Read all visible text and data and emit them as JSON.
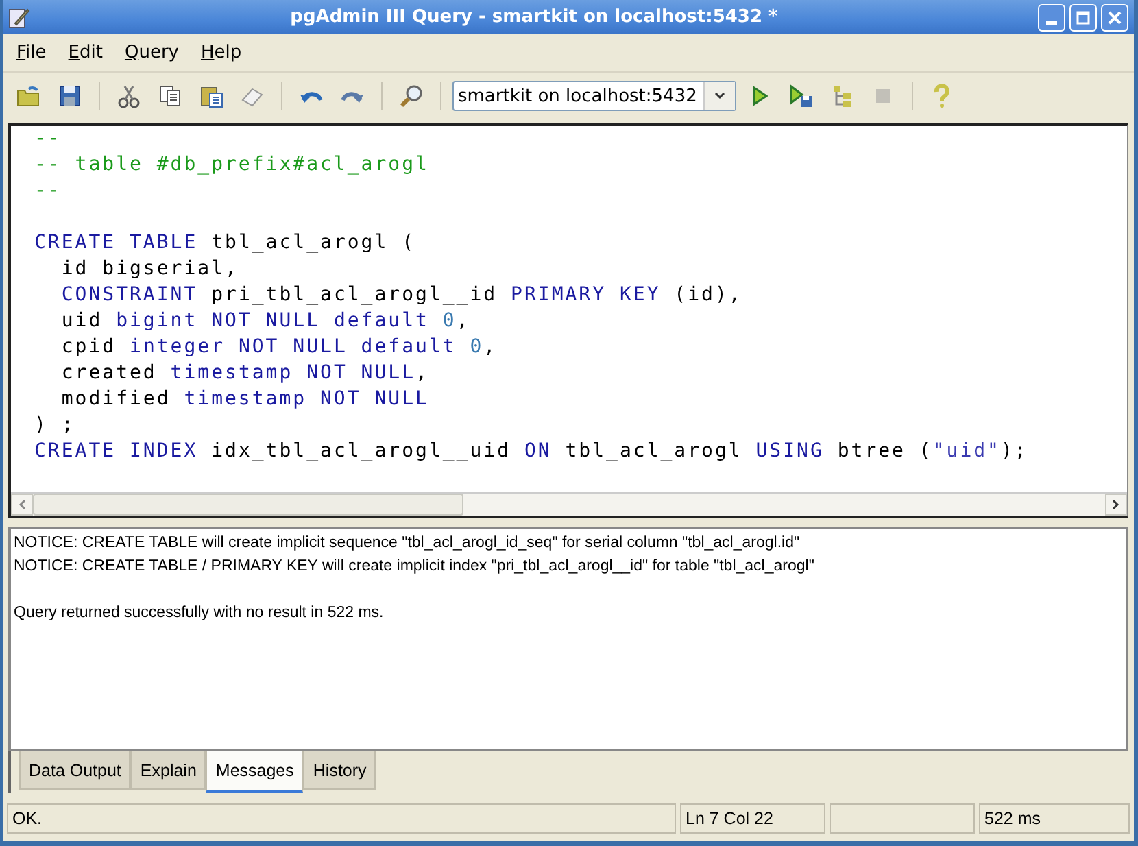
{
  "window": {
    "title": "pgAdmin III Query - smartkit on localhost:5432 *"
  },
  "menu": [
    {
      "label": "File"
    },
    {
      "label": "Edit"
    },
    {
      "label": "Query"
    },
    {
      "label": "Help"
    }
  ],
  "toolbar": {
    "buttons": [
      {
        "disabled": false
      },
      {
        "disabled": false
      },
      {
        "disabled": false
      },
      {
        "disabled": false
      },
      {
        "disabled": false
      },
      {
        "disabled": false
      },
      {
        "disabled": false
      },
      {
        "disabled": false
      },
      {
        "disabled": false
      }
    ],
    "connection": {
      "value": "smartkit on localhost:5432"
    },
    "run_buttons": [
      {
        "disabled": false
      },
      {
        "disabled": false
      },
      {
        "disabled": false
      },
      {
        "disabled": true
      },
      {
        "disabled": false
      }
    ]
  },
  "editor": {
    "lines": [
      {
        "kind": "code",
        "tokens": [
          {
            "kind": "comment",
            "text": "--"
          }
        ]
      },
      {
        "kind": "code",
        "tokens": [
          {
            "kind": "comment",
            "text": "-- table #db_prefix#acl_arogl"
          }
        ]
      },
      {
        "kind": "code",
        "tokens": [
          {
            "kind": "comment",
            "text": "--"
          }
        ]
      },
      {
        "kind": "blank"
      },
      {
        "kind": "code",
        "tokens": [
          {
            "kind": "keyword",
            "text": "CREATE TABLE"
          },
          {
            "kind": "plain",
            "text": " tbl_acl_arogl ("
          }
        ]
      },
      {
        "kind": "code",
        "tokens": [
          {
            "kind": "plain",
            "text": "  id bigserial,"
          }
        ]
      },
      {
        "kind": "code",
        "tokens": [
          {
            "kind": "keyword",
            "text": "  CONSTRAINT"
          },
          {
            "kind": "plain",
            "text": " pri_tbl_acl_arogl__id "
          },
          {
            "kind": "keyword",
            "text": "PRIMARY KEY"
          },
          {
            "kind": "plain",
            "text": " (id),"
          }
        ]
      },
      {
        "kind": "code",
        "tokens": [
          {
            "kind": "plain",
            "text": "  uid "
          },
          {
            "kind": "keyword",
            "text": "bigint NOT NULL default"
          },
          {
            "kind": "number",
            "text": " 0"
          },
          {
            "kind": "plain",
            "text": ","
          }
        ]
      },
      {
        "kind": "code",
        "tokens": [
          {
            "kind": "plain",
            "text": "  cpid "
          },
          {
            "kind": "keyword",
            "text": "integer NOT NULL default"
          },
          {
            "kind": "number",
            "text": " 0"
          },
          {
            "kind": "plain",
            "text": ","
          }
        ]
      },
      {
        "kind": "code",
        "tokens": [
          {
            "kind": "plain",
            "text": "  created "
          },
          {
            "kind": "keyword",
            "text": "timestamp NOT NULL"
          },
          {
            "kind": "plain",
            "text": ","
          }
        ]
      },
      {
        "kind": "code",
        "tokens": [
          {
            "kind": "plain",
            "text": "  modified "
          },
          {
            "kind": "keyword",
            "text": "timestamp NOT NULL"
          }
        ]
      },
      {
        "kind": "code",
        "tokens": [
          {
            "kind": "plain",
            "text": ") ;"
          }
        ]
      },
      {
        "kind": "code",
        "tokens": [
          {
            "kind": "keyword",
            "text": "CREATE INDEX"
          },
          {
            "kind": "plain",
            "text": " idx_tbl_acl_arogl__uid "
          },
          {
            "kind": "keyword",
            "text": "ON"
          },
          {
            "kind": "plain",
            "text": " tbl_acl_arogl "
          },
          {
            "kind": "keyword",
            "text": "USING"
          },
          {
            "kind": "plain",
            "text": " btree ("
          },
          {
            "kind": "string",
            "text": "\"uid\""
          },
          {
            "kind": "plain",
            "text": ");"
          }
        ]
      }
    ]
  },
  "messages": [
    {
      "kind": "notice",
      "text": "NOTICE:  CREATE TABLE will create implicit sequence \"tbl_acl_arogl_id_seq\" for serial column \"tbl_acl_arogl.id\""
    },
    {
      "kind": "notice",
      "text": "NOTICE:  CREATE TABLE / PRIMARY KEY will create implicit index \"pri_tbl_acl_arogl__id\" for table \"tbl_acl_arogl\""
    },
    {
      "kind": "result",
      "text": "Query returned successfully with no result in 522 ms."
    }
  ],
  "tabs": [
    {
      "label": "Data Output",
      "selected": false
    },
    {
      "label": "Explain",
      "selected": false
    },
    {
      "label": "Messages",
      "selected": true
    },
    {
      "label": "History",
      "selected": false
    }
  ],
  "status_bar": {
    "message": "OK.",
    "position": "Ln 7 Col 22",
    "time": "522 ms"
  }
}
